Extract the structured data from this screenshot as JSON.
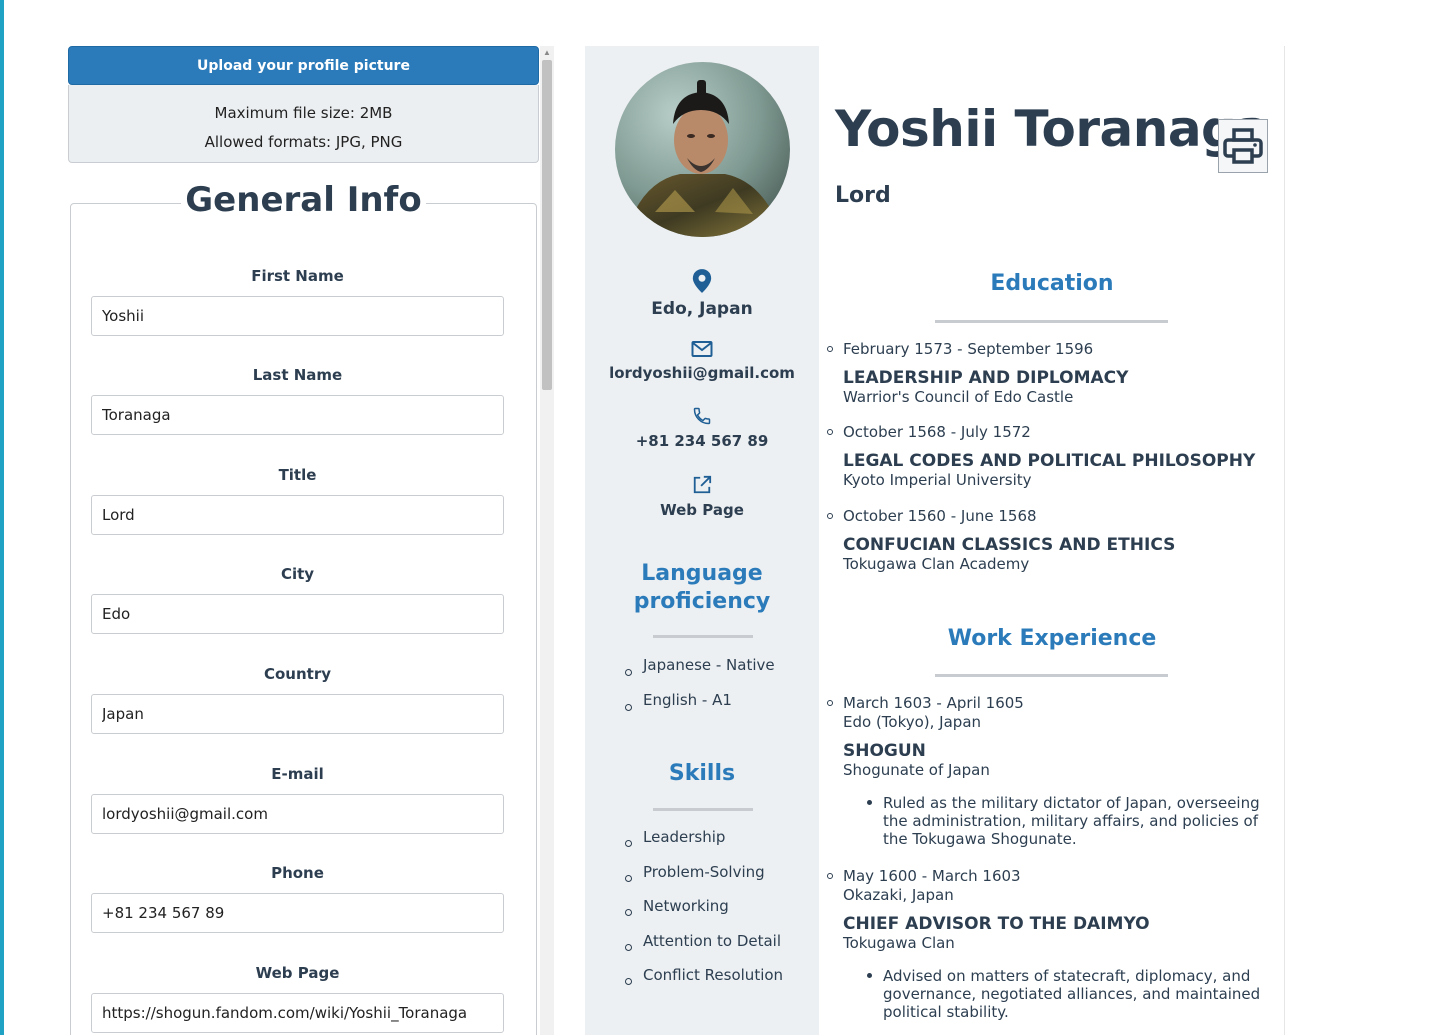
{
  "upload": {
    "button_label": "Upload your profile picture",
    "max_size": "Maximum file size: 2MB",
    "formats": "Allowed formats: JPG, PNG"
  },
  "general_info": {
    "heading": "General Info",
    "fields": [
      {
        "label": "First Name",
        "value": "Yoshii"
      },
      {
        "label": "Last Name",
        "value": "Toranaga"
      },
      {
        "label": "Title",
        "value": "Lord"
      },
      {
        "label": "City",
        "value": "Edo"
      },
      {
        "label": "Country",
        "value": "Japan"
      },
      {
        "label": "E-mail",
        "value": "lordyoshii@gmail.com"
      },
      {
        "label": "Phone",
        "value": "+81 234 567 89"
      },
      {
        "label": "Web Page",
        "value": "https://shogun.fandom.com/wiki/Yoshii_Toranaga"
      }
    ]
  },
  "cv": {
    "name": "Yoshii Toranaga",
    "title": "Lord",
    "contact": {
      "location": "Edo, Japan",
      "email": "lordyoshii@gmail.com",
      "phone": "+81 234 567 89",
      "web": "Web Page"
    },
    "languages_heading_1": "Language",
    "languages_heading_2": "proficiency",
    "languages": [
      "Japanese - Native",
      "English - A1"
    ],
    "skills_heading": "Skills",
    "skills": [
      "Leadership",
      "Problem-Solving",
      "Networking",
      "Attention to Detail",
      "Conflict Resolution"
    ],
    "education_heading": "Education",
    "education": [
      {
        "date": "February 1573 - September 1596",
        "role": "Leadership and Diplomacy",
        "org": "Warrior's Council of Edo Castle"
      },
      {
        "date": "October 1568 - July 1572",
        "role": "Legal Codes and Political Philosophy",
        "org": "Kyoto Imperial University"
      },
      {
        "date": "October 1560 - June 1568",
        "role": "Confucian Classics and Ethics",
        "org": "Tokugawa Clan Academy"
      }
    ],
    "work_heading": "Work Experience",
    "work": [
      {
        "date": "March 1603 - April 1605",
        "location": "Edo (Tokyo), Japan",
        "role": "Shogun",
        "org": "Shogunate of Japan",
        "description": "Ruled as the military dictator of Japan, overseeing the administration, military affairs, and policies of the Tokugawa Shogunate."
      },
      {
        "date": "May 1600 - March 1603",
        "location": "Okazaki, Japan",
        "role": "Chief Advisor to the Daimyo",
        "org": "Tokugawa Clan",
        "description": "Advised on matters of statecraft, diplomacy, and governance, negotiated alliances, and maintained political stability."
      }
    ]
  },
  "icons": {
    "location": "map-pin-icon",
    "email": "envelope-icon",
    "phone": "phone-icon",
    "web": "external-link-icon",
    "print": "printer-icon"
  },
  "colors": {
    "accent": "#2b7bba",
    "text": "#2c3e50",
    "sidebar_bg": "#edf0f2",
    "left_edge": "#1fa2c4"
  }
}
